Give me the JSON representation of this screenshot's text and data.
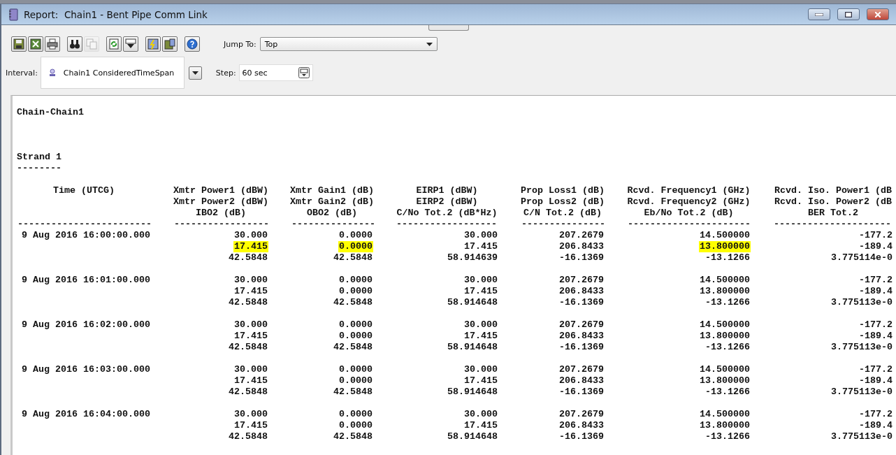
{
  "window": {
    "title": "Report:  Chain1 - Bent Pipe Comm Link"
  },
  "toolbar": {
    "buttons": [
      {
        "kind": "save",
        "disabled": false
      },
      {
        "kind": "export",
        "disabled": false
      },
      {
        "kind": "print",
        "disabled": false
      },
      {
        "kind": "find",
        "disabled": false
      },
      {
        "kind": "copy",
        "disabled": true
      },
      {
        "kind": "refresh",
        "disabled": false
      },
      {
        "kind": "filter",
        "disabled": false
      },
      {
        "kind": "properties",
        "disabled": false
      },
      {
        "kind": "save-options",
        "disabled": false
      },
      {
        "kind": "help",
        "disabled": false
      }
    ],
    "jump_to": {
      "label": "Jump To:",
      "value": "Top"
    }
  },
  "interval": {
    "label": "Interval:",
    "value": "Chain1 ConsideredTimeSpan"
  },
  "step": {
    "label": "Step:",
    "value": "60 sec"
  },
  "report": {
    "title": "Chain-Chain1",
    "section": "Strand 1",
    "section_rule": "--------",
    "columns": [
      {
        "header": [
          "Time (UTCG)"
        ],
        "rule": "------------------------"
      },
      {
        "header": [
          "Xmtr Power1 (dBW)",
          "Xmtr Power2 (dBW)",
          "IBO2 (dB)"
        ],
        "rule": "-----------------"
      },
      {
        "header": [
          "Xmtr Gain1 (dB)",
          "Xmtr Gain2 (dB)",
          "OBO2 (dB)"
        ],
        "rule": "---------------"
      },
      {
        "header": [
          "EIRP1 (dBW)",
          "EIRP2 (dBW)",
          "C/No Tot.2 (dB*Hz)"
        ],
        "rule": "------------------"
      },
      {
        "header": [
          "Prop Loss1 (dB)",
          "Prop Loss2 (dB)",
          "C/N Tot.2 (dB)"
        ],
        "rule": "---------------"
      },
      {
        "header": [
          "Rcvd. Frequency1 (GHz)",
          "Rcvd. Frequency2 (GHz)",
          "Eb/No Tot.2 (dB)"
        ],
        "rule": "----------------------"
      },
      {
        "header": [
          "Rcvd. Iso. Power1 (dB",
          "Rcvd. Iso. Power2 (dB",
          "BER Tot.2"
        ],
        "rule": "---------------------"
      }
    ],
    "records": [
      {
        "time": "9 Aug 2016 16:00:00.000",
        "cells": [
          {
            "values": [
              "30.000",
              "17.415",
              "42.5848"
            ],
            "highlighted": [
              false,
              true,
              false
            ]
          },
          {
            "values": [
              "0.0000",
              "0.0000",
              "42.5848"
            ],
            "highlighted": [
              false,
              true,
              false
            ]
          },
          {
            "values": [
              "30.000",
              "17.415",
              "58.914639"
            ],
            "highlighted": [
              false,
              false,
              false
            ]
          },
          {
            "values": [
              "207.2679",
              "206.8433",
              "-16.1369"
            ],
            "highlighted": [
              false,
              false,
              false
            ]
          },
          {
            "values": [
              "14.500000",
              "13.800000",
              "-13.1266"
            ],
            "highlighted": [
              false,
              true,
              false
            ]
          },
          {
            "values": [
              "-177.2",
              "-189.4",
              "3.775114e-0"
            ],
            "highlighted": [
              false,
              false,
              false
            ]
          }
        ]
      },
      {
        "time": "9 Aug 2016 16:01:00.000",
        "cells": [
          {
            "values": [
              "30.000",
              "17.415",
              "42.5848"
            ],
            "highlighted": [
              false,
              false,
              false
            ]
          },
          {
            "values": [
              "0.0000",
              "0.0000",
              "42.5848"
            ],
            "highlighted": [
              false,
              false,
              false
            ]
          },
          {
            "values": [
              "30.000",
              "17.415",
              "58.914648"
            ],
            "highlighted": [
              false,
              false,
              false
            ]
          },
          {
            "values": [
              "207.2679",
              "206.8433",
              "-16.1369"
            ],
            "highlighted": [
              false,
              false,
              false
            ]
          },
          {
            "values": [
              "14.500000",
              "13.800000",
              "-13.1266"
            ],
            "highlighted": [
              false,
              false,
              false
            ]
          },
          {
            "values": [
              "-177.2",
              "-189.4",
              "3.775113e-0"
            ],
            "highlighted": [
              false,
              false,
              false
            ]
          }
        ]
      },
      {
        "time": "9 Aug 2016 16:02:00.000",
        "cells": [
          {
            "values": [
              "30.000",
              "17.415",
              "42.5848"
            ],
            "highlighted": [
              false,
              false,
              false
            ]
          },
          {
            "values": [
              "0.0000",
              "0.0000",
              "42.5848"
            ],
            "highlighted": [
              false,
              false,
              false
            ]
          },
          {
            "values": [
              "30.000",
              "17.415",
              "58.914648"
            ],
            "highlighted": [
              false,
              false,
              false
            ]
          },
          {
            "values": [
              "207.2679",
              "206.8433",
              "-16.1369"
            ],
            "highlighted": [
              false,
              false,
              false
            ]
          },
          {
            "values": [
              "14.500000",
              "13.800000",
              "-13.1266"
            ],
            "highlighted": [
              false,
              false,
              false
            ]
          },
          {
            "values": [
              "-177.2",
              "-189.4",
              "3.775113e-0"
            ],
            "highlighted": [
              false,
              false,
              false
            ]
          }
        ]
      },
      {
        "time": "9 Aug 2016 16:03:00.000",
        "cells": [
          {
            "values": [
              "30.000",
              "17.415",
              "42.5848"
            ],
            "highlighted": [
              false,
              false,
              false
            ]
          },
          {
            "values": [
              "0.0000",
              "0.0000",
              "42.5848"
            ],
            "highlighted": [
              false,
              false,
              false
            ]
          },
          {
            "values": [
              "30.000",
              "17.415",
              "58.914648"
            ],
            "highlighted": [
              false,
              false,
              false
            ]
          },
          {
            "values": [
              "207.2679",
              "206.8433",
              "-16.1369"
            ],
            "highlighted": [
              false,
              false,
              false
            ]
          },
          {
            "values": [
              "14.500000",
              "13.800000",
              "-13.1266"
            ],
            "highlighted": [
              false,
              false,
              false
            ]
          },
          {
            "values": [
              "-177.2",
              "-189.4",
              "3.775113e-0"
            ],
            "highlighted": [
              false,
              false,
              false
            ]
          }
        ]
      },
      {
        "time": "9 Aug 2016 16:04:00.000",
        "cells": [
          {
            "values": [
              "30.000",
              "17.415",
              "42.5848"
            ],
            "highlighted": [
              false,
              false,
              false
            ]
          },
          {
            "values": [
              "0.0000",
              "0.0000",
              "42.5848"
            ],
            "highlighted": [
              false,
              false,
              false
            ]
          },
          {
            "values": [
              "30.000",
              "17.415",
              "58.914648"
            ],
            "highlighted": [
              false,
              false,
              false
            ]
          },
          {
            "values": [
              "207.2679",
              "206.8433",
              "-16.1369"
            ],
            "highlighted": [
              false,
              false,
              false
            ]
          },
          {
            "values": [
              "14.500000",
              "13.800000",
              "-13.1266"
            ],
            "highlighted": [
              false,
              false,
              false
            ]
          },
          {
            "values": [
              "-177.2",
              "-189.4",
              "3.775113e-0"
            ],
            "highlighted": [
              false,
              false,
              false
            ]
          }
        ]
      }
    ]
  }
}
